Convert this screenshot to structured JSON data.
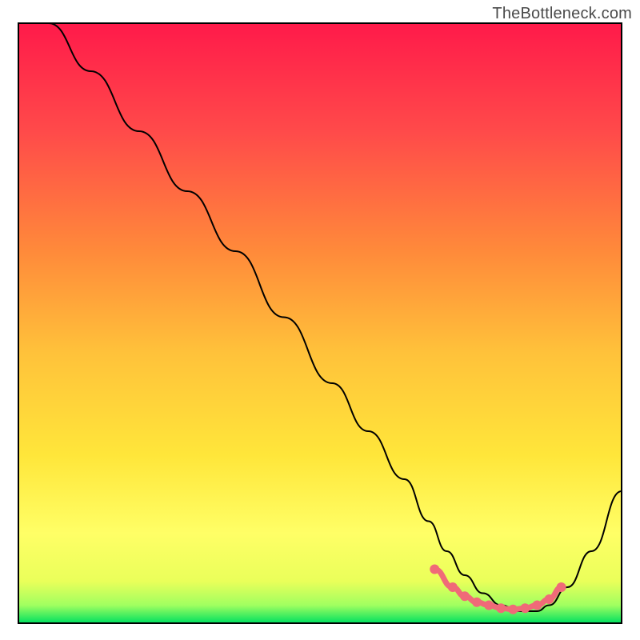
{
  "watermark": "TheBottleneck.com",
  "chart_data": {
    "type": "line",
    "title": "",
    "xlabel": "",
    "ylabel": "",
    "xlim": [
      0,
      100
    ],
    "ylim": [
      0,
      100
    ],
    "axes_visible": false,
    "gradient_background": {
      "top": "#ff1a4a",
      "mid_upper": "#ff7a3a",
      "mid": "#ffd63a",
      "mid_lower": "#ffff66",
      "bottom": "#00e060"
    },
    "series": [
      {
        "name": "curve",
        "color": "#000000",
        "x": [
          5,
          12,
          20,
          28,
          36,
          44,
          52,
          58,
          64,
          68,
          71,
          74,
          77,
          80,
          83,
          86,
          88,
          91,
          95,
          100
        ],
        "y": [
          100,
          92,
          82,
          72,
          62,
          51,
          40,
          32,
          24,
          17,
          12,
          8,
          5,
          3,
          2,
          2,
          3,
          6,
          12,
          22
        ]
      },
      {
        "name": "bottom-markers",
        "color": "#f06a78",
        "style": "line-with-dots",
        "x": [
          69,
          72,
          74,
          76,
          78,
          80,
          82,
          84,
          86,
          88,
          90
        ],
        "y": [
          9,
          6,
          4.5,
          3.5,
          3,
          2.5,
          2.3,
          2.5,
          3,
          4,
          6
        ]
      }
    ],
    "border": {
      "color": "#000000",
      "width": 2
    }
  }
}
